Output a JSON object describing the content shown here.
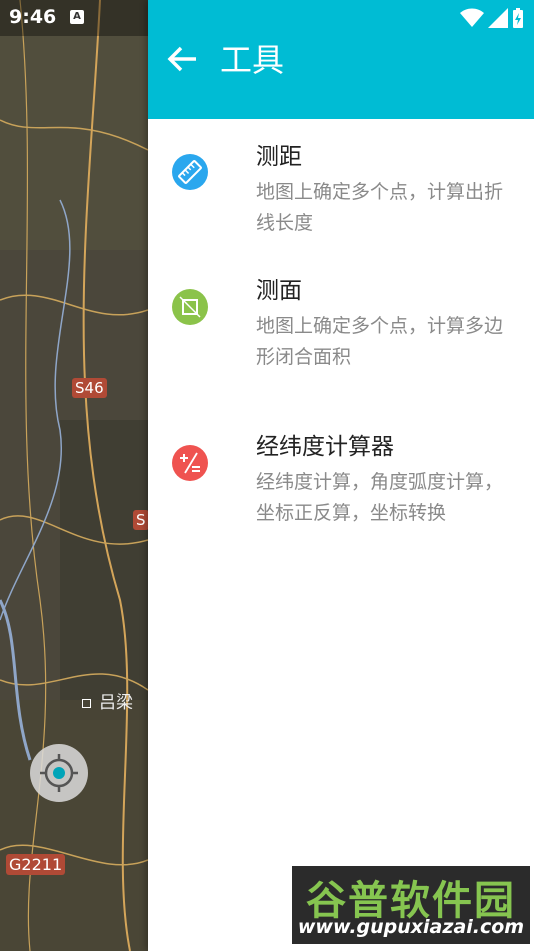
{
  "status": {
    "time": "9:46",
    "notification_icon": "A"
  },
  "header": {
    "title": "工具"
  },
  "tools": [
    {
      "title": "测距",
      "desc": "地图上确定多个点，计算出折线长度",
      "icon": "ruler-icon",
      "color": "#2aa7ee"
    },
    {
      "title": "测面",
      "desc": "地图上确定多个点，计算多边形闭合面积",
      "icon": "crop-square-icon",
      "color": "#8bc34a"
    },
    {
      "title": "经纬度计算器",
      "desc": "经纬度计算，角度弧度计算，坐标正反算，坐标转换",
      "icon": "calculator-icon",
      "color": "#ef5350"
    }
  ],
  "map": {
    "labels": [
      "S46",
      "S",
      "吕梁",
      "G2211"
    ]
  },
  "watermark": {
    "brand": "谷普软件园",
    "url": "www.gupuxiazai.com"
  }
}
